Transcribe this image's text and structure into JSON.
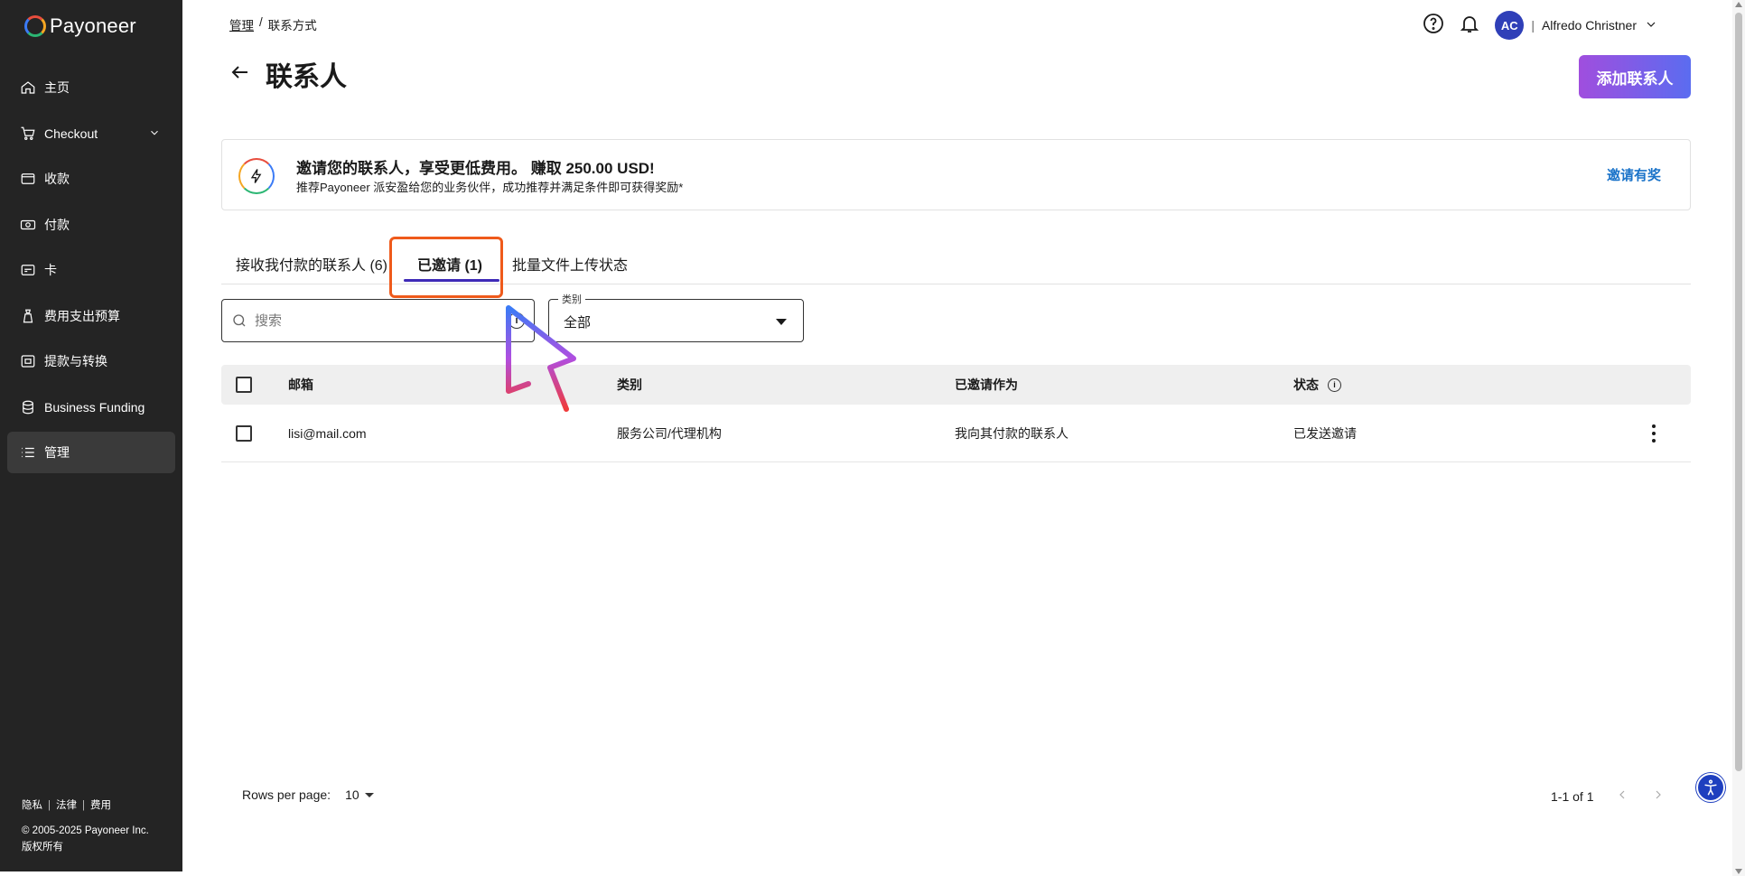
{
  "app": {
    "brand": "Payoneer"
  },
  "sidebar": {
    "items": [
      {
        "label": "主页",
        "icon": "home-icon"
      },
      {
        "label": "Checkout",
        "icon": "cart-icon"
      },
      {
        "label": "收款",
        "icon": "wallet-icon"
      },
      {
        "label": "付款",
        "icon": "payment-icon"
      },
      {
        "label": "卡",
        "icon": "card-icon"
      },
      {
        "label": "费用支出预算",
        "icon": "budget-icon"
      },
      {
        "label": "提款与转换",
        "icon": "withdraw-icon"
      },
      {
        "label": "Business Funding",
        "icon": "funding-icon"
      },
      {
        "label": "管理",
        "icon": "list-icon"
      }
    ],
    "active_index": 8,
    "footer": {
      "privacy": "隐私",
      "legal": "法律",
      "fees": "费用",
      "copyright": "© 2005-2025 Payoneer Inc.",
      "rights": "版权所有"
    }
  },
  "header": {
    "breadcrumb": {
      "parent": "管理",
      "separator": "/",
      "current": "联系方式"
    },
    "title": "联系人",
    "user": {
      "initials": "AC",
      "name": "Alfredo Christner"
    },
    "add_button": "添加联系人"
  },
  "banner": {
    "title": "邀请您的联系人，享受更低费用。 赚取 250.00 USD!",
    "subtitle": "推荐Payoneer 派安盈给您的业务伙伴，成功推荐并满足条件即可获得奖励*",
    "link": "邀请有奖"
  },
  "tabs": [
    {
      "label": "接收我付款的联系人 (6)"
    },
    {
      "label": "已邀请 (1)",
      "selected": true
    },
    {
      "label": "批量文件上传状态"
    }
  ],
  "filters": {
    "search_placeholder": "搜索",
    "category_label": "类别",
    "category_value": "全部"
  },
  "table": {
    "columns": [
      "邮箱",
      "类别",
      "已邀请作为",
      "状态"
    ],
    "rows": [
      {
        "email": "lisi@mail.com",
        "category": "服务公司/代理机构",
        "invited_as": "我向其付款的联系人",
        "status": "已发送邀请"
      }
    ]
  },
  "pagination": {
    "rows_per_page_label": "Rows per page:",
    "rows_per_page": "10",
    "range": "1-1 of 1"
  },
  "colors": {
    "sidebar_bg": "#242424",
    "accent": "#3e2ab7",
    "link": "#1a73c9",
    "highlight": "#ef5a1b",
    "button_gradient_start": "#a04ede",
    "button_gradient_end": "#5b6cf0"
  }
}
